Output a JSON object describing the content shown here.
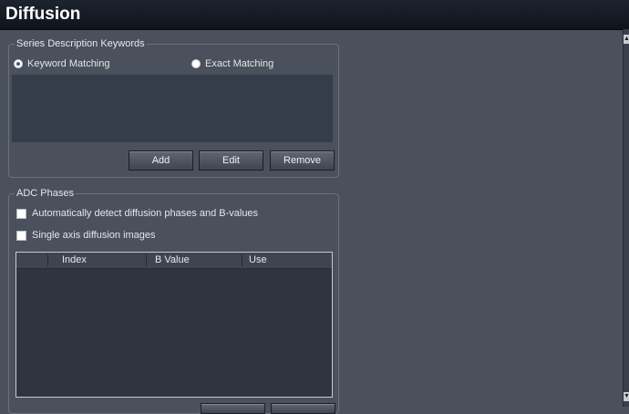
{
  "window": {
    "title": "Diffusion"
  },
  "series_group": {
    "legend": "Series Description Keywords",
    "radios": [
      {
        "label": "Keyword Matching",
        "checked": true
      },
      {
        "label": "Exact Matching",
        "checked": false
      }
    ],
    "buttons": {
      "add": "Add",
      "edit": "Edit",
      "remove": "Remove"
    }
  },
  "adc_group": {
    "legend": "ADC Phases",
    "checkboxes": [
      {
        "label": "Automatically detect diffusion phases and B-values",
        "checked": false
      },
      {
        "label": "Single axis diffusion images",
        "checked": false
      }
    ],
    "table": {
      "columns": [
        "Index",
        "B Value",
        "Use"
      ],
      "rows": []
    }
  },
  "scrollbar": {
    "up_icon": "arrow-up-icon",
    "down_icon": "arrow-down-icon"
  }
}
